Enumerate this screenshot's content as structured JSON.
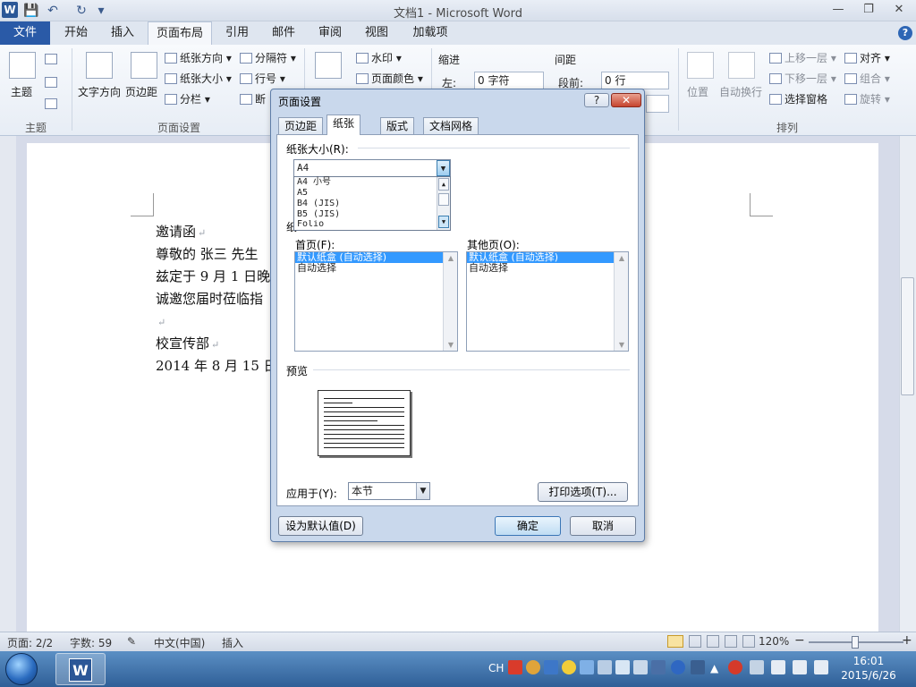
{
  "window": {
    "title": "文档1 - Microsoft Word",
    "app_icon_letter": "W",
    "qat_save": "💾",
    "qat_undo": "↶",
    "qat_redo": "↻",
    "qat_more": "▾",
    "min": "—",
    "max": "❐",
    "close": "✕"
  },
  "ribbon_tabs": [
    "文件",
    "开始",
    "插入",
    "页面布局",
    "引用",
    "邮件",
    "审阅",
    "视图",
    "加载项"
  ],
  "ribbon": {
    "themes": {
      "label": "主题",
      "group": "主题"
    },
    "page_setup": {
      "text_direction": "文字方向",
      "margins": "页边距",
      "orientation": "纸张方向",
      "size": "纸张大小",
      "columns": "分栏",
      "breaks": "分隔符",
      "line_numbers": "行号",
      "hyphenation": "断",
      "group": "页面设置"
    },
    "page_background": {
      "watermark": "水印",
      "page_color": "页面颜色"
    },
    "paragraph": {
      "indent": "缩进",
      "indent_left": "左:",
      "indent_left_value": "0 字符",
      "spacing": "间距",
      "spacing_before": "段前:",
      "spacing_before_value": "0 行"
    },
    "arrange": {
      "position": "位置",
      "wrap": "自动换行",
      "bring_forward": "上移一层",
      "send_backward": "下移一层",
      "selection_pane": "选择窗格",
      "align": "对齐",
      "group_btn": "组合",
      "rotate": "旋转",
      "group": "排列"
    }
  },
  "document": {
    "lines": [
      "邀请函",
      "尊敬的 张三 先生",
      "兹定于 9 月 1 日晚",
      "诚邀您届时莅临指",
      "",
      "校宣传部",
      "2014 年 8 月 15 日"
    ],
    "para_mark": "↵"
  },
  "dialog": {
    "title": "页面设置",
    "help": "?",
    "close": "✕",
    "tabs": [
      "页边距",
      "纸张",
      "版式",
      "文档网格"
    ],
    "paper_size_label": "纸张大小(R):",
    "paper_size_value": "A4",
    "paper_size_options": [
      "A4 小号",
      "A5",
      "B4 (JIS)",
      "B5 (JIS)",
      "Folio"
    ],
    "paper_source_label": "纸",
    "first_page_label": "首页(F):",
    "other_pages_label": "其他页(O):",
    "tray_options": [
      "默认纸盒 (自动选择)",
      "自动选择"
    ],
    "preview_label": "预览",
    "apply_to_label": "应用于(Y):",
    "apply_to_value": "本节",
    "print_options": "打印选项(T)...",
    "set_default": "设为默认值(D)",
    "ok": "确定",
    "cancel": "取消"
  },
  "status": {
    "page": "页面: 2/2",
    "words": "字数: 59",
    "language": "中文(中国)",
    "mode": "插入",
    "zoom": "120%",
    "zoom_minus": "−",
    "zoom_plus": "+"
  },
  "taskbar": {
    "ime": "CH",
    "time": "16:01",
    "date": "2015/6/26"
  }
}
